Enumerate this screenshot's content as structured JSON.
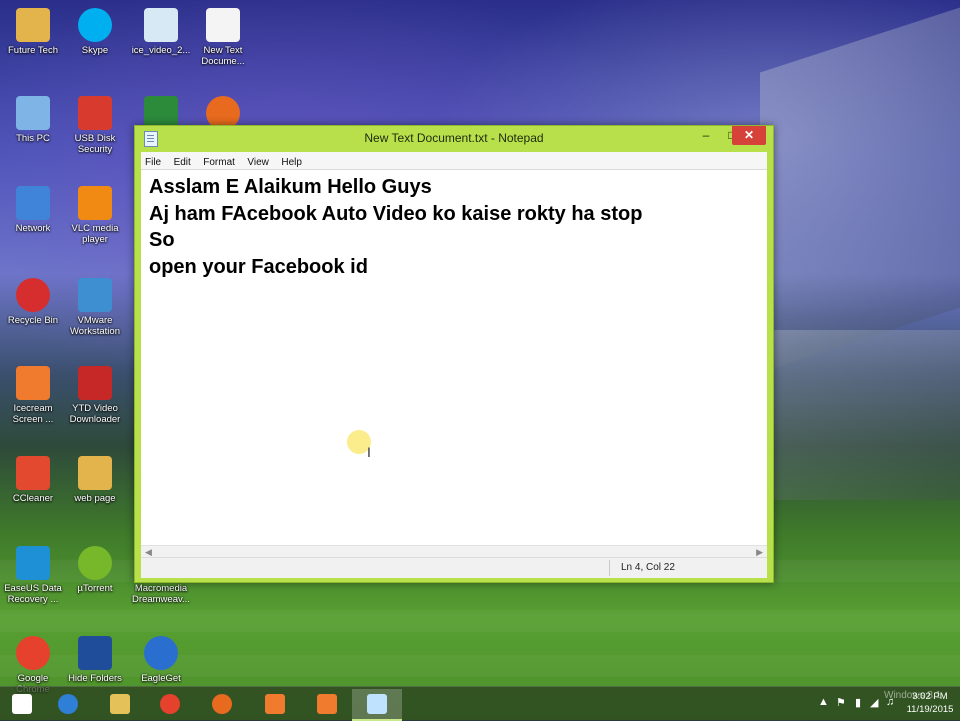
{
  "desktop": {
    "icons": [
      {
        "label": "Future Tech",
        "icon": "folder-icon",
        "color": "#e2b44b"
      },
      {
        "label": "Skype",
        "icon": "skype-icon",
        "color": "#00aff0"
      },
      {
        "label": "ice_video_2...",
        "icon": "video-file-icon",
        "color": "#d7e9f5"
      },
      {
        "label": "New Text\nDocume...",
        "icon": "text-file-icon",
        "color": "#f4f4f4"
      },
      {
        "label": "This PC",
        "icon": "computer-icon",
        "color": "#7fb4e6"
      },
      {
        "label": "USB Disk\nSecurity",
        "icon": "shield-icon",
        "color": "#d83b2d"
      },
      {
        "label": "",
        "icon": "internet-download-manager-icon",
        "color": "#2c8a3b"
      },
      {
        "label": "",
        "icon": "firefox-icon",
        "color": "#e86a1e"
      },
      {
        "label": "Network",
        "icon": "network-icon",
        "color": "#3f84d8"
      },
      {
        "label": "VLC media\nplayer",
        "icon": "vlc-icon",
        "color": "#f08a13"
      },
      {
        "label": "Recycle Bin",
        "icon": "recycle-bin-icon",
        "color": "#d62e2e"
      },
      {
        "label": "VMware\nWorkstation",
        "icon": "vmware-icon",
        "color": "#3d8fd1"
      },
      {
        "label": "Icecream\nScreen ...",
        "icon": "icecream-recorder-icon",
        "color": "#f07a2d"
      },
      {
        "label": "YTD Video\nDownloader",
        "icon": "ytd-icon",
        "color": "#c62828"
      },
      {
        "label": "CCleaner",
        "icon": "ccleaner-icon",
        "color": "#e2492f"
      },
      {
        "label": "web page",
        "icon": "folder-icon",
        "color": "#e2b44b"
      },
      {
        "label": "EaseUS Data\nRecovery ...",
        "icon": "easeus-icon",
        "color": "#1e90d6"
      },
      {
        "label": "µTorrent",
        "icon": "utorrent-icon",
        "color": "#76b82a"
      },
      {
        "label": "Macromedia\nDreamweav...",
        "icon": "dreamweaver-icon",
        "color": "#2e7d32"
      },
      {
        "label": "Google\nChrome",
        "icon": "chrome-icon",
        "color": "#e5412d"
      },
      {
        "label": "Hide Folders",
        "icon": "hide-folders-icon",
        "color": "#1f4d9a"
      },
      {
        "label": "EagleGet",
        "icon": "eagleget-icon",
        "color": "#2a6fcf"
      }
    ]
  },
  "notepad": {
    "title": "New Text Document.txt - Notepad",
    "menu": [
      "File",
      "Edit",
      "Format",
      "View",
      "Help"
    ],
    "lines": [
      "Asslam E Alaikum Hello Guys",
      "Aj ham FAcebook Auto Video ko kaise rokty ha stop",
      "So",
      "open your Facebook id"
    ],
    "status": "Ln 4, Col 22",
    "minimize_glyph": "–",
    "maximize_glyph": "□",
    "close_glyph": "✕"
  },
  "taskbar": {
    "apps": [
      {
        "icon": "start-windows-icon",
        "color": "#ffffff"
      },
      {
        "icon": "internet-explorer-icon",
        "color": "#2f7fd6"
      },
      {
        "icon": "file-explorer-icon",
        "color": "#e5c15a"
      },
      {
        "icon": "chrome-icon",
        "color": "#e5412d"
      },
      {
        "icon": "firefox-icon",
        "color": "#e86a1e"
      },
      {
        "icon": "icecream-recorder-icon",
        "color": "#f07a2d"
      },
      {
        "icon": "screen-capture-icon",
        "color": "#f07a2d"
      },
      {
        "icon": "notepad-icon",
        "color": "#bfe3ff"
      }
    ],
    "time": "3:02 PM",
    "date": "11/19/2015",
    "watermark": "Windows 8.1"
  }
}
